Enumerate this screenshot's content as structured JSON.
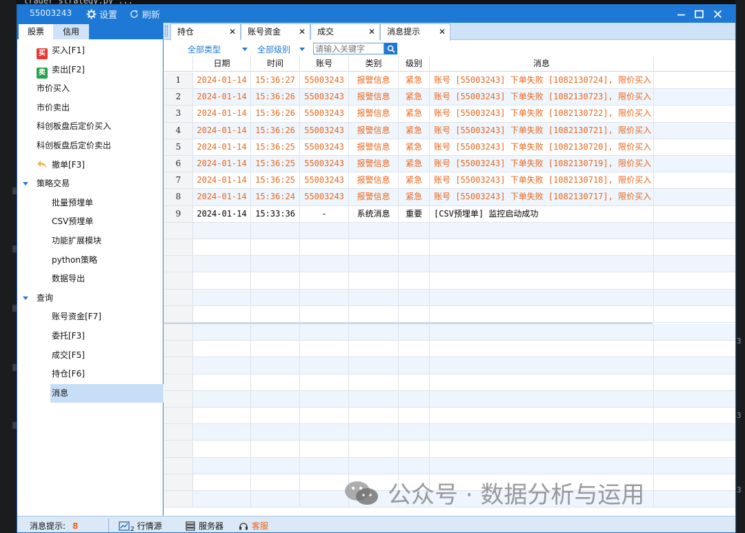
{
  "background": {
    "top_text": "trader strategy.py ...",
    "right_numbers": [
      "3",
      "3",
      "3"
    ]
  },
  "window": {
    "account": "55003243",
    "settings_label": "设置",
    "refresh_label": "刷新",
    "accent_color": "#1e78d6"
  },
  "left_tabs": [
    "股票",
    "信用"
  ],
  "menu": {
    "buy": {
      "badge": "买",
      "label": "买入[F1]"
    },
    "sell": {
      "badge": "卖",
      "label": "卖出[F2]"
    },
    "market_buy": "市价买入",
    "market_sell": "市价卖出",
    "star_after_buy": "科创板盘后定价买入",
    "star_after_sell": "科创板盘后定价卖出",
    "cancel": "撤单[F3]",
    "strategy_group": "策略交易",
    "batch": "批量预埋单",
    "csv": "CSV预埋单",
    "ext": "功能扩展模块",
    "python": "python策略",
    "export": "数据导出",
    "query_group": "查询",
    "q_funds": "账号资金[F7]",
    "q_orders": "委托[F3]",
    "q_trades": "成交[F5]",
    "q_positions": "持仓[F6]",
    "q_messages": "消息"
  },
  "tabs": [
    {
      "label": "持仓"
    },
    {
      "label": "账号资金"
    },
    {
      "label": "成交"
    },
    {
      "label": "消息提示"
    }
  ],
  "filter": {
    "type": "全部类型",
    "level": "全部级别",
    "placeholder": "请输入关键字"
  },
  "table": {
    "headers": [
      "",
      "日期",
      "时间",
      "账号",
      "类别",
      "级别",
      "消息"
    ],
    "rows": [
      [
        "1",
        "2024-01-14",
        "15:36:27",
        "55003243",
        "报警信息",
        "紧急",
        "账号 [55003243] 下单失败 [1082130724], 限价买入"
      ],
      [
        "2",
        "2024-01-14",
        "15:36:26",
        "55003243",
        "报警信息",
        "紧急",
        "账号 [55003243] 下单失败 [1082130723], 限价买入"
      ],
      [
        "3",
        "2024-01-14",
        "15:36:26",
        "55003243",
        "报警信息",
        "紧急",
        "账号 [55003243] 下单失败 [1082130722], 限价买入"
      ],
      [
        "4",
        "2024-01-14",
        "15:36:26",
        "55003243",
        "报警信息",
        "紧急",
        "账号 [55003243] 下单失败 [1082130721], 限价买入"
      ],
      [
        "5",
        "2024-01-14",
        "15:36:25",
        "55003243",
        "报警信息",
        "紧急",
        "账号 [55003243] 下单失败 [1082130720], 限价买入"
      ],
      [
        "6",
        "2024-01-14",
        "15:36:25",
        "55003243",
        "报警信息",
        "紧急",
        "账号 [55003243] 下单失败 [1082130719], 限价买入"
      ],
      [
        "7",
        "2024-01-14",
        "15:36:25",
        "55003243",
        "报警信息",
        "紧急",
        "账号 [55003243] 下单失败 [1082130718], 限价买入"
      ],
      [
        "8",
        "2024-01-14",
        "15:36:24",
        "55003243",
        "报警信息",
        "紧急",
        "账号 [55003243] 下单失败 [1082130717], 限价买入"
      ],
      [
        "9",
        "2024-01-14",
        "15:33:36",
        "-",
        "系统消息",
        "重要",
        "[CSV预埋单] 监控启动成功"
      ]
    ],
    "warn_color": "#e8661b"
  },
  "status": {
    "msg_label": "消息提示:",
    "msg_count": "8",
    "market": "行情源",
    "market_sub": "2",
    "server": "服务器",
    "service": "客服"
  },
  "watermark": "公众号 · 数据分析与运用"
}
